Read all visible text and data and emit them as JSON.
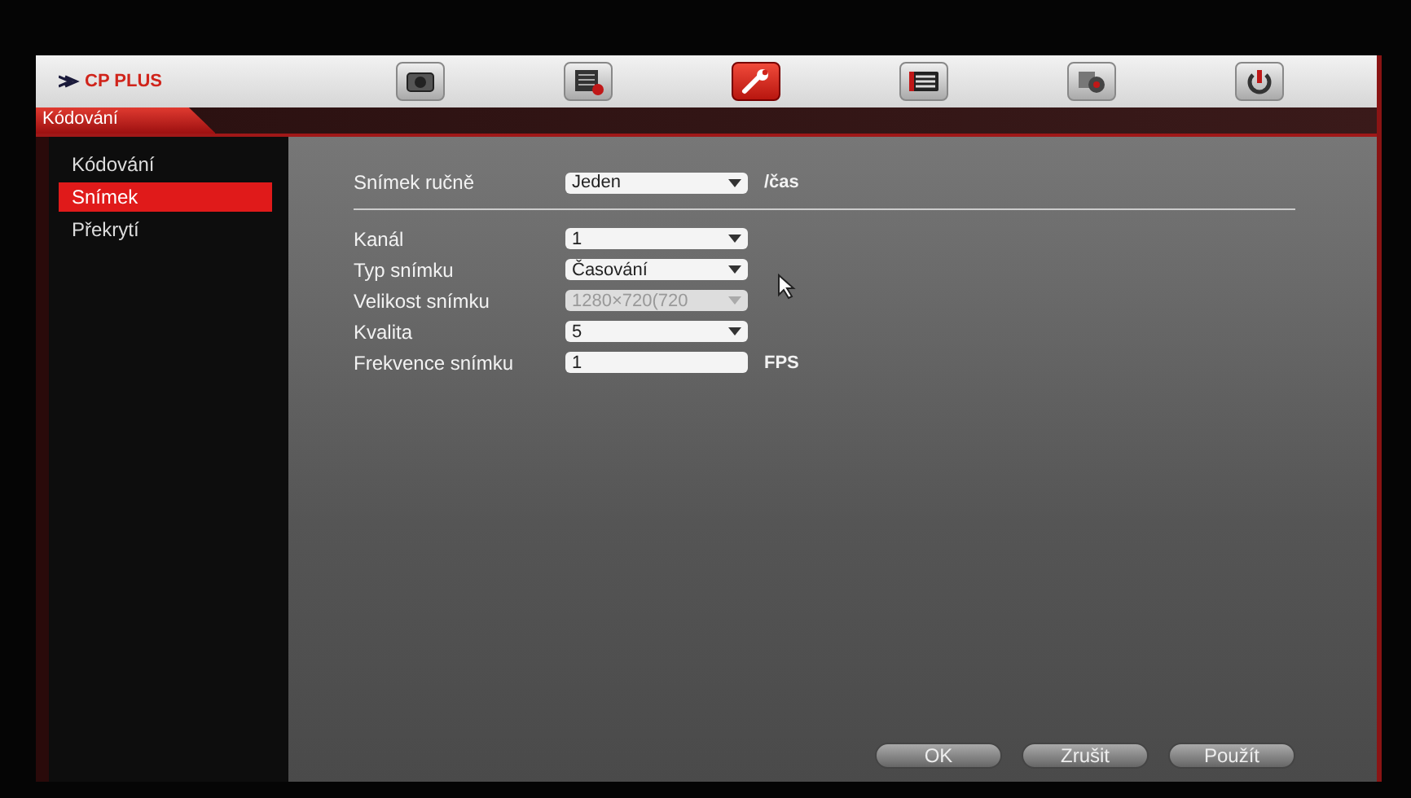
{
  "logo": "CP PLUS",
  "toolbar": [
    {
      "kind": "camera",
      "selected": false
    },
    {
      "kind": "list",
      "selected": false
    },
    {
      "kind": "wrench",
      "selected": true
    },
    {
      "kind": "menu",
      "selected": false
    },
    {
      "kind": "devices",
      "selected": false
    },
    {
      "kind": "power",
      "selected": false
    }
  ],
  "section_title": "Kódování",
  "sidebar": [
    {
      "label": "Kódování",
      "selected": false
    },
    {
      "label": "Snímek",
      "selected": true
    },
    {
      "label": "Překrytí",
      "selected": false
    }
  ],
  "manual_snapshot": {
    "label": "Snímek ručně",
    "value": "Jeden",
    "suffix": "/čas"
  },
  "fields": [
    {
      "label": "Kanál",
      "kind": "select",
      "value": "1",
      "disabled": false
    },
    {
      "label": "Typ snímku",
      "kind": "select",
      "value": "Časování",
      "disabled": false
    },
    {
      "label": "Velikost snímku",
      "kind": "select",
      "value": "1280×720(720",
      "disabled": true
    },
    {
      "label": "Kvalita",
      "kind": "select",
      "value": "5",
      "disabled": false
    },
    {
      "label": "Frekvence snímku",
      "kind": "input",
      "value": "1",
      "unit": "FPS",
      "disabled": false
    }
  ],
  "buttons": [
    "OK",
    "Zrušit",
    "Použít"
  ]
}
